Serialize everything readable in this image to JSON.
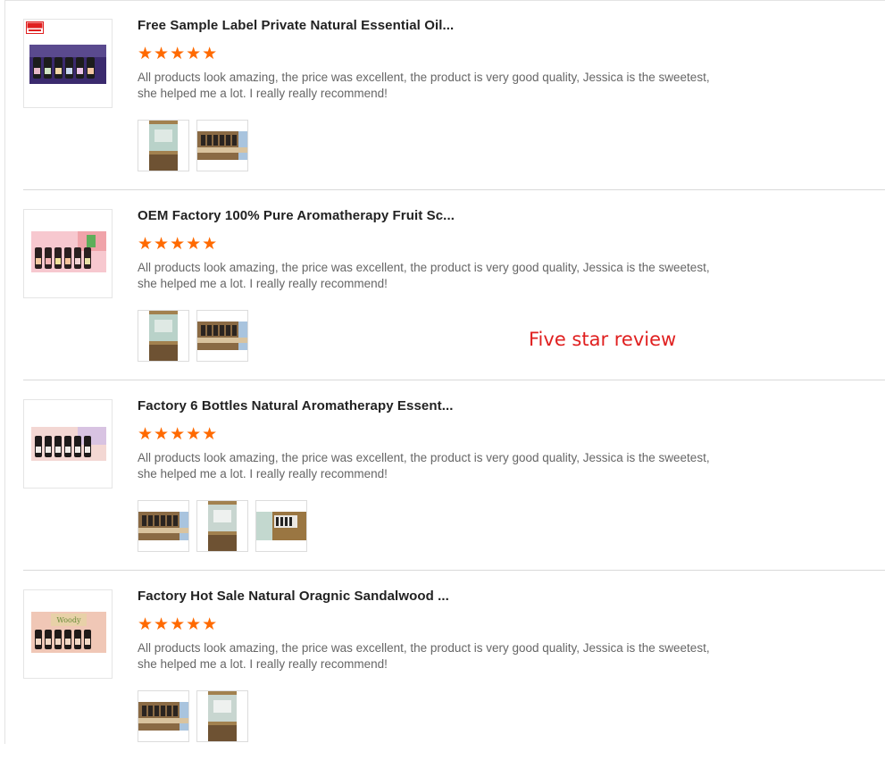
{
  "reviews": [
    {
      "title": "Free Sample Label Private Natural Essential Oil...",
      "stars": "★★★★★",
      "rating": 5,
      "text": "All products look amazing, the price was excellent, the product is very good quality, Jessica is the sweetest, she helped me a lot. I really really recommend!",
      "badge": "FREE SAMPLE",
      "photos": [
        "box-photo",
        "bottles-photo"
      ]
    },
    {
      "title": "OEM Factory 100% Pure Aromatherapy Fruit Sc...",
      "stars": "★★★★★",
      "rating": 5,
      "text": "All products look amazing, the price was excellent, the product is very good quality, Jessica is the sweetest, she helped me a lot. I really really recommend!",
      "photos": [
        "box-photo",
        "bottles-photo"
      ]
    },
    {
      "title": "Factory 6 Bottles Natural Aromatherapy Essent...",
      "stars": "★★★★★",
      "rating": 5,
      "text": "All products look amazing, the price was excellent, the product is very good quality, Jessica is the sweetest, she helped me a lot. I really really recommend!",
      "photos": [
        "bottles-photo",
        "box-photo",
        "package-photo"
      ]
    },
    {
      "title": "Factory Hot Sale Natural Oragnic Sandalwood ...",
      "stars": "★★★★★",
      "rating": 5,
      "text": "All products look amazing, the price was excellent, the product is very good quality, Jessica is the sweetest, she helped me a lot. I really really recommend!",
      "product_label": "Woody",
      "photos": [
        "bottles-photo",
        "box-photo"
      ]
    }
  ],
  "annotation": "Five star review",
  "colors": {
    "star": "#ff6a00",
    "annotation": "#e02020",
    "title": "#222222",
    "body": "#666666"
  }
}
